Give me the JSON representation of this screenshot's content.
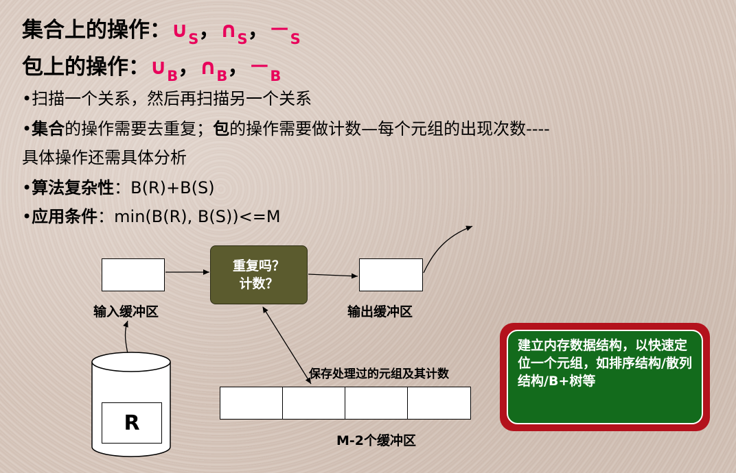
{
  "heading1": {
    "label": "集合上的操作：",
    "ops": [
      {
        "symbol": "∪",
        "sub": "S"
      },
      {
        "symbol": "∩",
        "sub": "S"
      },
      {
        "symbol": "－",
        "sub": "S"
      }
    ]
  },
  "heading2": {
    "label": "包上的操作：",
    "ops": [
      {
        "symbol": "∪",
        "sub": "B"
      },
      {
        "symbol": "∩",
        "sub": "B"
      },
      {
        "symbol": "－",
        "sub": "B"
      }
    ]
  },
  "separator": "，",
  "bullets": {
    "b1": "•扫描一个关系，然后再扫描另一个关系",
    "b2_mark": "•",
    "b2_set": "集合",
    "b2_mid": "的操作需要去重复；",
    "b2_bag": "包",
    "b2_end": "的操作需要做计数—每个元组的出现次数----",
    "b2_line2": "具体操作还需具体分析",
    "b3_mark": "•",
    "b3_bold": "算法复杂性",
    "b3_rest": "：B(R)+B(S)",
    "b4_mark": "•",
    "b4_bold": "应用条件",
    "b4_rest": "：min(B(R), B(S))<=M"
  },
  "diagram": {
    "center_line1": "重复吗？",
    "center_line2": "计数？",
    "input_buffer": "输入缓冲区",
    "output_buffer": "输出缓冲区",
    "saved_tuples": "保存处理过的元组及其计数",
    "m2_buffers": "M-2个缓冲区",
    "relation": "R"
  },
  "note": "建立内存数据结构，以快速定位一个元组，如排序结构/散列结构/B+树等",
  "colors": {
    "operator": "#e8005a",
    "center_box": "#5b5b2e",
    "note_border": "#b3121c",
    "note_fill": "#136b1c"
  }
}
